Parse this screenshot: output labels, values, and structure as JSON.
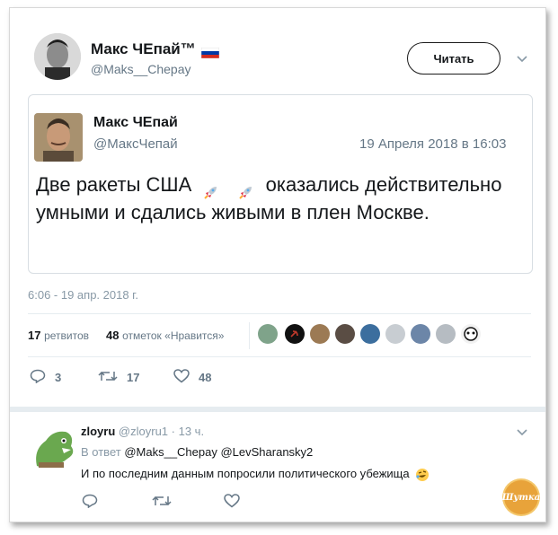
{
  "tweet": {
    "author_name": "Макс ЧЕпай™",
    "author_handle": "@Maks__Chepay",
    "follow_label": "Читать",
    "timestamp": "6:06 - 19 апр. 2018 г.",
    "stats": {
      "retweets_count": "17",
      "retweets_label": "ретвитов",
      "likes_count": "48",
      "likes_label": "отметок «Нравится»"
    },
    "actions": {
      "replies": "3",
      "retweets": "17",
      "likes": "48"
    }
  },
  "quoted": {
    "author_name": "Макс ЧЕпай",
    "author_handle": "@МаксЧепай",
    "date": "19 Апреля 2018 в 16:03",
    "text_part1": "Две ракеты США",
    "text_part2": "оказались действительно",
    "text_line2": "умными и сдались живыми в плен Москве."
  },
  "reply": {
    "author_name": "zloyru",
    "author_handle": "@zloyru1",
    "time": "· 13 ч.",
    "reply_to_prefix": "В ответ",
    "reply_to_1": "@Maks__Chepay",
    "reply_to_2": "@LevSharansky2",
    "text": "И по последним данным попросили политического убежища"
  },
  "watermark": {
    "text": "Шутка"
  },
  "colors": {
    "accent": "#1b95e0",
    "muted": "#657786",
    "russian_flag": [
      "#ffffff",
      "#0039a6",
      "#d52b1e"
    ]
  },
  "icons": [
    "russian-flag-icon",
    "chevron-down-icon",
    "rocket-emoji-icon",
    "reply-icon",
    "retweet-icon",
    "heart-icon",
    "rofl-emoji-icon"
  ]
}
